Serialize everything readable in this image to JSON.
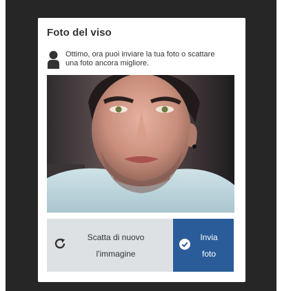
{
  "dialog": {
    "title": "Foto del viso",
    "message_line1": "Ottimo, ora puoi inviare la tua foto o scattare",
    "message_line2": "una foto ancora migliore."
  },
  "actions": {
    "retake_line1": "Scatta di nuovo",
    "retake_line2": "l'immagine",
    "send_line1": "Invia",
    "send_line2": "foto"
  },
  "icons": {
    "user": "user-silhouette-icon",
    "retake": "refresh-icon",
    "send": "check-circle-icon"
  },
  "colors": {
    "backdrop": "#262626",
    "retake_button": "#dde1e4",
    "send_button": "#2b5c9a",
    "text": "#333333"
  }
}
